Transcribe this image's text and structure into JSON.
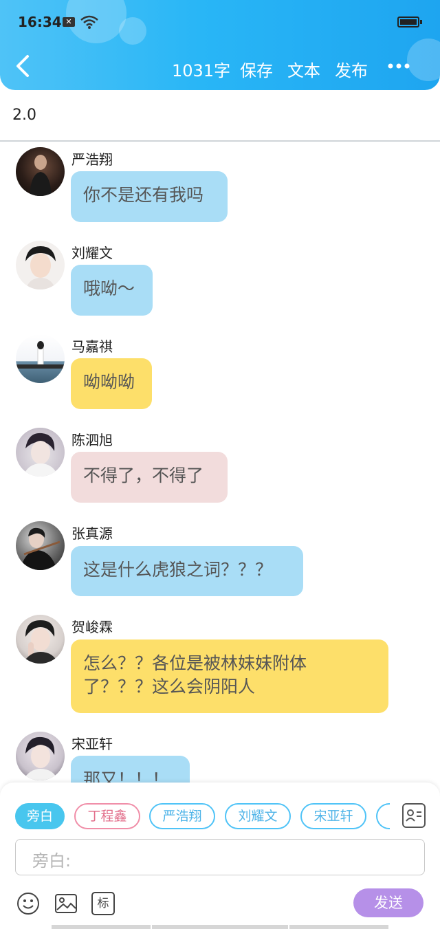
{
  "status_bar": {
    "time": "16:34"
  },
  "toolbar": {
    "word_count": "1031字",
    "save": "保存",
    "text": "文本",
    "publish": "发布"
  },
  "document": {
    "title": "2.0"
  },
  "messages": [
    {
      "name": "严浩翔",
      "text": "你不是还有我吗",
      "color": "#a9ddf6"
    },
    {
      "name": "刘耀文",
      "text": "哦呦～",
      "color": "#a9ddf6"
    },
    {
      "name": "马嘉祺",
      "text": "呦呦呦",
      "color": "#fddf6a"
    },
    {
      "name": "陈泗旭",
      "text": "不得了，不得了",
      "color": "#f2dcdc"
    },
    {
      "name": "张真源",
      "text": "这是什么虎狼之词？？？",
      "color": "#a9ddf6"
    },
    {
      "name": "贺峻霖",
      "text_line1": "怎么？？各位是被林妹妹附体",
      "text_line2": "了？？？这么会阴阳人",
      "color": "#fddf6a"
    },
    {
      "name": "宋亚轩",
      "text": "那又！！！",
      "color": "#a9ddf6"
    }
  ],
  "composer": {
    "roles": [
      "旁白",
      "丁程鑫",
      "严浩翔",
      "刘耀文",
      "宋亚轩"
    ],
    "placeholder": "旁白:",
    "send": "发送",
    "tools": [
      "emoji-icon",
      "image-icon",
      "tag-icon"
    ],
    "tag_label": "标"
  }
}
